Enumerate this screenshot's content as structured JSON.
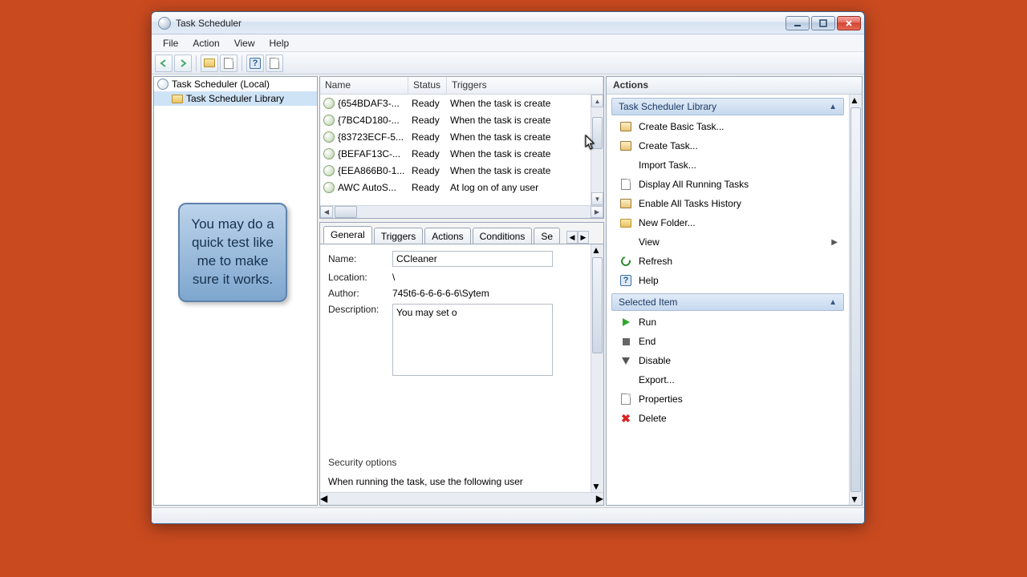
{
  "window": {
    "title": "Task Scheduler"
  },
  "menubar": [
    "File",
    "Action",
    "View",
    "Help"
  ],
  "tree": {
    "root": "Task Scheduler (Local)",
    "child": "Task Scheduler Library"
  },
  "columns": {
    "name": "Name",
    "status": "Status",
    "triggers": "Triggers"
  },
  "tasks": [
    {
      "name": "{654BDAF3-...",
      "status": "Ready",
      "triggers": "When the task is create"
    },
    {
      "name": "{7BC4D180-...",
      "status": "Ready",
      "triggers": "When the task is create"
    },
    {
      "name": "{83723ECF-5...",
      "status": "Ready",
      "triggers": "When the task is create"
    },
    {
      "name": "{BEFAF13C-...",
      "status": "Ready",
      "triggers": "When the task is create"
    },
    {
      "name": "{EEA866B0-1...",
      "status": "Ready",
      "triggers": "When the task is create"
    },
    {
      "name": "AWC AutoS...",
      "status": "Ready",
      "triggers": "At log on of any user"
    }
  ],
  "tabs": [
    "General",
    "Triggers",
    "Actions",
    "Conditions",
    "Se"
  ],
  "general": {
    "name_label": "Name:",
    "name_value": "CCleaner",
    "location_label": "Location:",
    "location_value": "\\",
    "author_label": "Author:",
    "author_value": "745t6-6-6-6-6-6\\Sytem",
    "description_label": "Description:",
    "description_value": "You may set o",
    "security_header": "Security options",
    "security_text": "When running the task, use the following user"
  },
  "actions_panel": {
    "title": "Actions",
    "group1": "Task Scheduler Library",
    "items1": [
      "Create Basic Task...",
      "Create Task...",
      "Import Task...",
      "Display All Running Tasks",
      "Enable All Tasks History",
      "New Folder...",
      "View",
      "Refresh",
      "Help"
    ],
    "group2": "Selected Item",
    "items2": [
      "Run",
      "End",
      "Disable",
      "Export...",
      "Properties",
      "Delete"
    ]
  },
  "callout": "You may do a quick test like me to make sure it works."
}
